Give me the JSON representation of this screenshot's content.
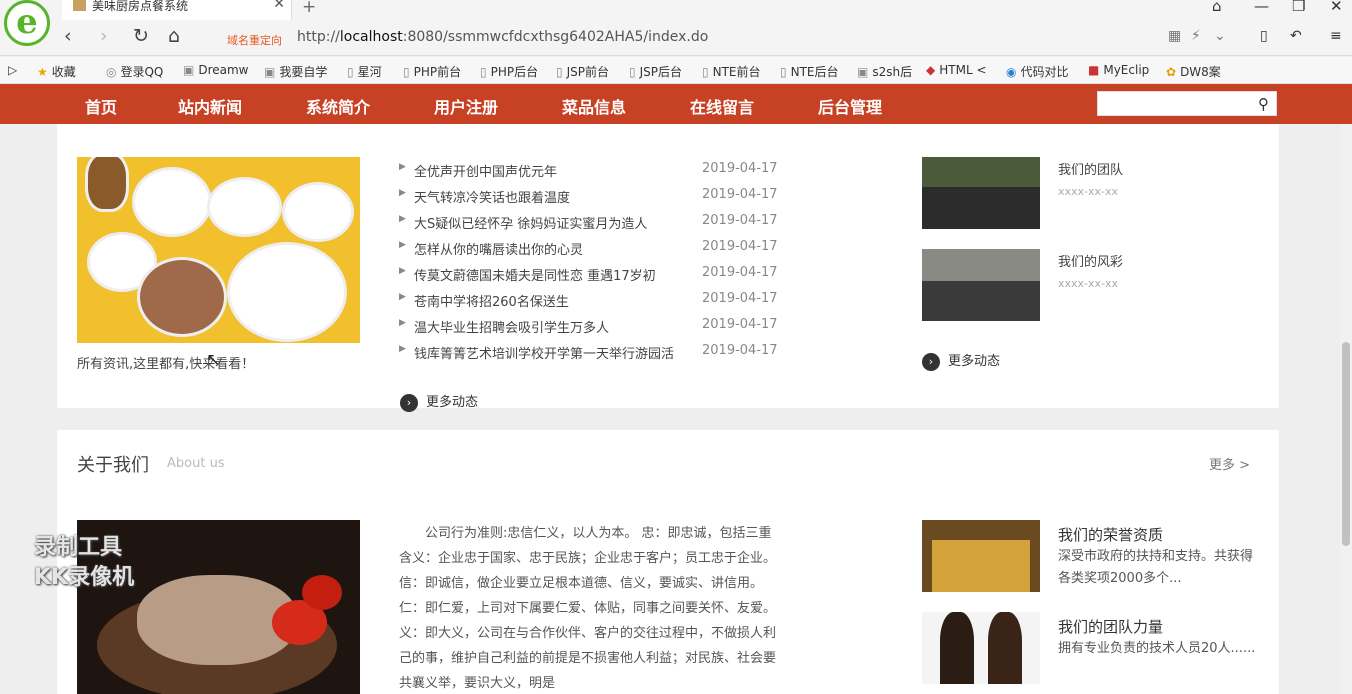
{
  "browser": {
    "tab_title": "美味厨房点餐系统",
    "redirect_label": "域名重定向",
    "url_prefix": "http://",
    "url_host": "localhost",
    "url_rest": ":8080/ssmmwcfdcxthsg6402AHA5/index.do",
    "bookmarks": [
      "收藏",
      "登录QQ",
      "Dreamw",
      "我要自学",
      "星河",
      "PHP前台",
      "PHP后台",
      "JSP前台",
      "JSP后台",
      "NTE前台",
      "NTE后台",
      "s2sh后",
      "HTML <",
      "代码对比",
      "MyEclip",
      "DW8案"
    ]
  },
  "nav": {
    "items": [
      "首页",
      "站内新闻",
      "系统简介",
      "用户注册",
      "菜品信息",
      "在线留言",
      "后台管理"
    ],
    "search_placeholder": ""
  },
  "news": {
    "caption": "所有资讯,这里都有,快来看看！",
    "items": [
      {
        "title": "全优声开创中国声优元年",
        "date": "2019-04-17"
      },
      {
        "title": "天气转凉冷笑话也跟着温度",
        "date": "2019-04-17"
      },
      {
        "title": "大S疑似已经怀孕 徐妈妈证实蜜月为造人",
        "date": "2019-04-17"
      },
      {
        "title": "怎样从你的嘴唇读出你的心灵",
        "date": "2019-04-17"
      },
      {
        "title": "传莫文蔚德国未婚夫是同性恋 重遇17岁初",
        "date": "2019-04-17"
      },
      {
        "title": "苍南中学将招260名保送生",
        "date": "2019-04-17"
      },
      {
        "title": "温大毕业生招聘会吸引学生万多人",
        "date": "2019-04-17"
      },
      {
        "title": "钱库箐箐艺术培训学校开学第一天举行游园活",
        "date": "2019-04-17"
      }
    ],
    "more": "更多动态"
  },
  "side": {
    "items": [
      {
        "title": "我们的团队",
        "date": "xxxx-xx-xx"
      },
      {
        "title": "我们的风彩",
        "date": "xxxx-xx-xx"
      }
    ],
    "more": "更多动态"
  },
  "about": {
    "title": "关于我们",
    "subtitle": "About us",
    "more": "更多 >",
    "text": "公司行为准则:忠信仁义，以人为本。 忠：即忠诚，包括三重含义：企业忠于国家、忠于民族；企业忠于客户；员工忠于企业。 信：即诚信，做企业要立足根本道德、信义，要诚实、讲信用。 仁：即仁爱，上司对下属要仁爱、体贴，同事之间要关怀、友爱。 义：即大义，公司在与合作伙伴、客户的交往过程中，不做损人利己的事，维护自己利益的前提是不损害他人利益；对民族、社会要共襄义举，要识大义，明是",
    "honors": [
      {
        "title": "我们的荣誉资质",
        "desc": "深受市政府的扶持和支持。共获得各类奖项2000多个..."
      },
      {
        "title": "我们的团队力量",
        "desc": "拥有专业负责的技术人员20人......"
      }
    ]
  },
  "watermark": {
    "line1": "录制工具",
    "line2": "KK录像机"
  },
  "colors": {
    "nav_red": "#c74125",
    "browser_green": "#58b52a"
  }
}
